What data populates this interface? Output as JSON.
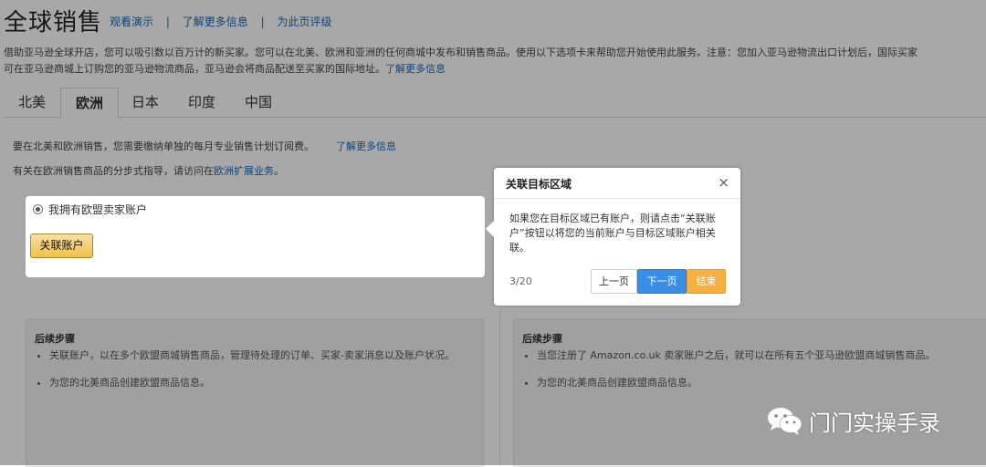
{
  "header": {
    "title": "全球销售",
    "links": [
      "观看演示",
      "了解更多信息",
      "为此页评级"
    ]
  },
  "intro": {
    "line1": "借助亚马逊全球开店，您可以吸引数以百万计的新买家。您可以在北美、欧洲和亚洲的任何商城中发布和销售商品。使用以下选项卡来帮助您开始使用此服务。注意：您加入亚马逊物流出口计划后，国际买家",
    "line2": "可在亚马逊商城上订购您的亚马逊物流商品，亚马逊会将商品配送至买家的国际地址。",
    "line2_link": "了解更多信息"
  },
  "tabs": [
    {
      "label": "北美",
      "active": false
    },
    {
      "label": "欧洲",
      "active": true
    },
    {
      "label": "日本",
      "active": false
    },
    {
      "label": "印度",
      "active": false
    },
    {
      "label": "中国",
      "active": false
    }
  ],
  "content": {
    "fee_text": "要在北美和欧洲销售，您需要缴纳单独的每月专业销售计划订阅费。",
    "fee_link": "了解更多信息",
    "guide_text": "有关在欧洲销售商品的分步式指导，请访问在",
    "guide_link": "欧洲扩展业务",
    "guide_suffix": "。",
    "radio_label": "我拥有欧盟卖家账户",
    "link_account_button": "关联账户"
  },
  "columns": [
    {
      "title": "后续步骤",
      "items": [
        "关联账户，以在多个欧盟商城销售商品，管理待处理的订单、买家-卖家消息以及账户状况。",
        "为您的北美商品创建欧盟商品信息。"
      ]
    },
    {
      "title": "后续步骤",
      "items": [
        "当您注册了 Amazon.co.uk 卖家账户之后，就可以在所有五个亚马逊欧盟商城销售商品。",
        "为您的北美商品创建欧盟商品信息。"
      ]
    }
  ],
  "popover": {
    "title": "关联目标区域",
    "close": "×",
    "body": "如果您在目标区域已有账户，则请点击“关联账户”按钮以将您的当前账户与目标区域账户相关联。",
    "count": "3/20",
    "prev": "上一页",
    "next": "下一页",
    "end": "结束"
  },
  "watermark": {
    "text": "门门实操手录",
    "icon": "wechat-icon"
  },
  "colors": {
    "link": "#1a66b5",
    "next_button": "#3a8ee6",
    "end_button": "#f5b041",
    "primary_button": "#f0c14b"
  }
}
